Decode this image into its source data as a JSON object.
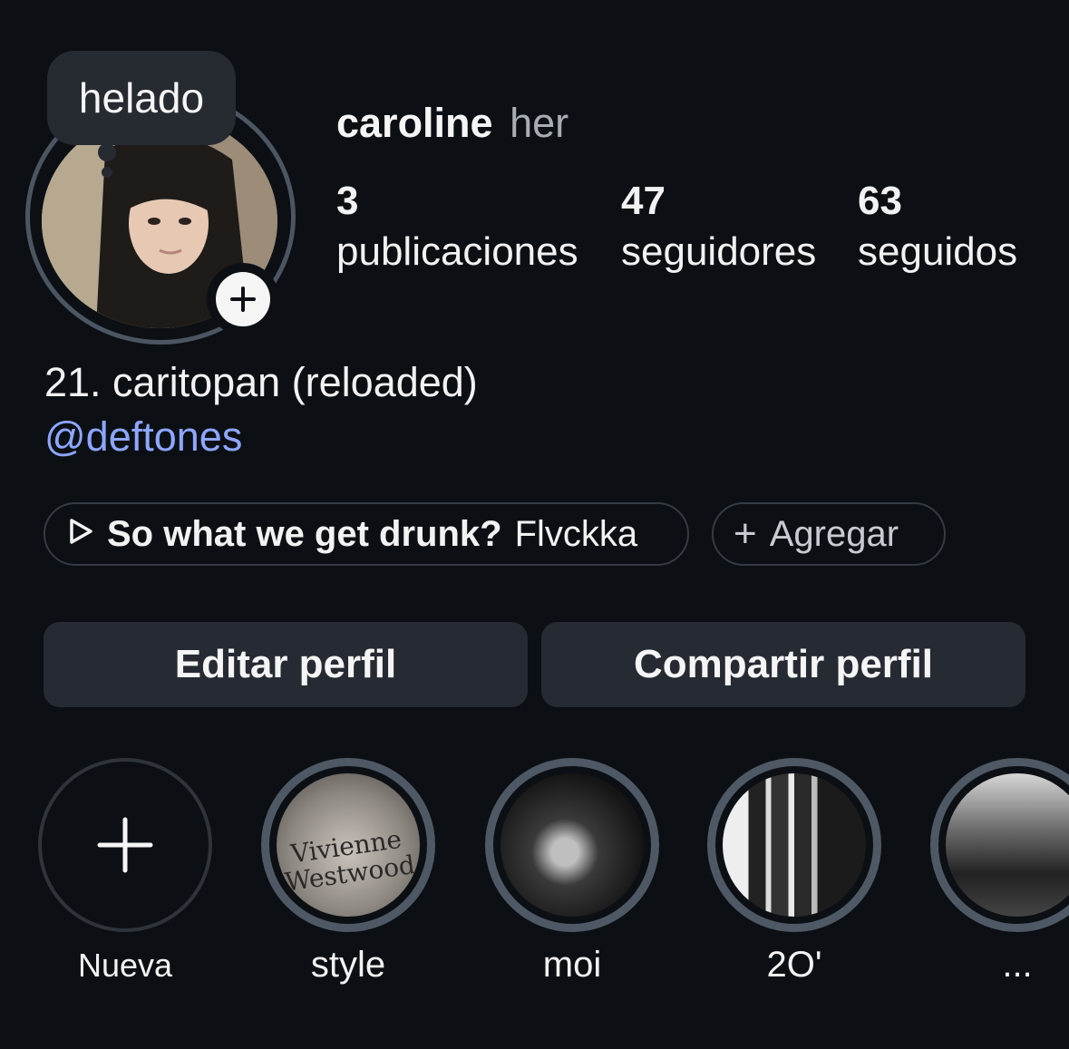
{
  "note": {
    "text": "helado"
  },
  "profile": {
    "username": "caroline",
    "pronouns": "her"
  },
  "stats": [
    {
      "value": "3",
      "label": "publicaciones"
    },
    {
      "value": "47",
      "label": "seguidores"
    },
    {
      "value": "63",
      "label": "seguidos"
    }
  ],
  "bio": {
    "line1": "21. caritopan (reloaded)",
    "mention": "@deftones"
  },
  "music": {
    "song": "So what we get drunk?",
    "artist": "Flvckka"
  },
  "add_link": {
    "label": "Agregar"
  },
  "buttons": {
    "edit": "Editar perfil",
    "share": "Compartir perfil"
  },
  "highlights": [
    {
      "label": "Nueva",
      "icon": "plus-icon"
    },
    {
      "label": "style",
      "cover_text": "Vivienne Westwood"
    },
    {
      "label": "moi"
    },
    {
      "label": "2O'"
    },
    {
      "label": "..."
    }
  ],
  "colors": {
    "background": "#0c1014",
    "button": "#262b33",
    "mention": "#8ea6ff",
    "ring": "#4f5966"
  }
}
